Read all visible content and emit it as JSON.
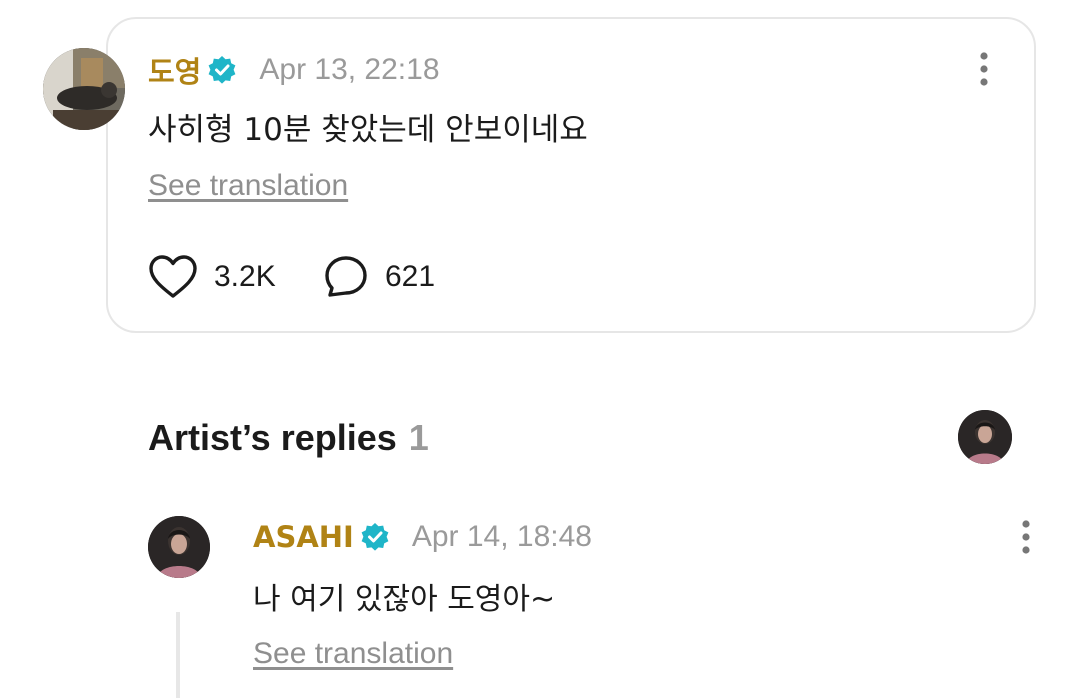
{
  "post": {
    "author": "도영",
    "timestamp": "Apr 13, 22:18",
    "text": "사히형 10분 찾았는데 안보이네요",
    "translate_label": "See translation",
    "likes": "3.2K",
    "comments": "621"
  },
  "artist_replies": {
    "title": "Artist’s replies",
    "count": "1"
  },
  "reply": {
    "author": "ASAHI",
    "timestamp": "Apr 14, 18:48",
    "text": "나 여기 있잖아 도영아~",
    "translate_label": "See translation"
  },
  "colors": {
    "author_name": "#b08315",
    "verified_badge": "#1fb5c8",
    "muted_text": "#9a9a9a",
    "card_border": "#e6e6e6"
  },
  "icons": {
    "verified": "verified-badge-icon",
    "more": "more-vertical-icon",
    "like": "heart-outline-icon",
    "comment": "speech-bubble-icon"
  }
}
